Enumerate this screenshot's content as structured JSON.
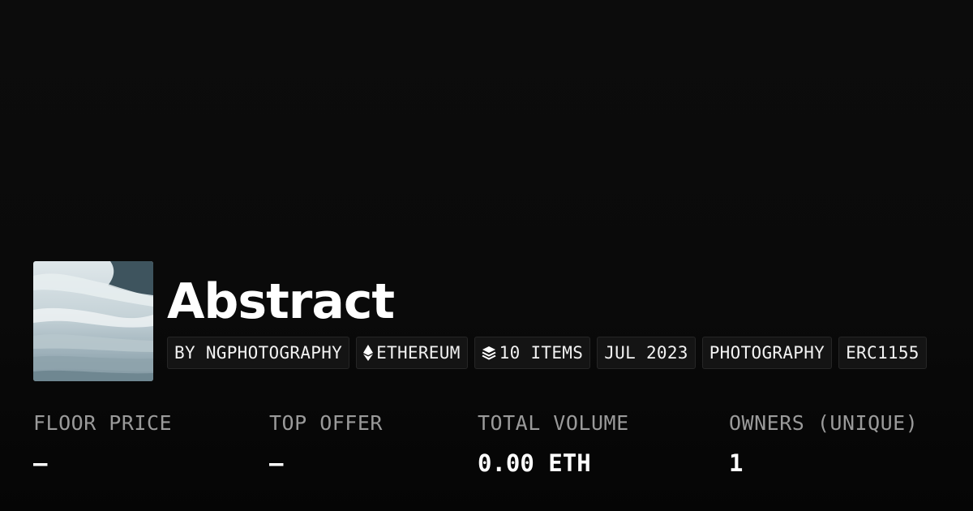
{
  "collection": {
    "name": "Abstract",
    "image_alt": "abstract photograph thumbnail"
  },
  "tags": [
    {
      "label": "BY NGPHOTOGRAPHY",
      "icon": null
    },
    {
      "label": "ETHEREUM",
      "icon": "ethereum-icon"
    },
    {
      "label": "10 ITEMS",
      "icon": "layers-icon"
    },
    {
      "label": "JUL 2023",
      "icon": null
    },
    {
      "label": "PHOTOGRAPHY",
      "icon": null
    },
    {
      "label": "ERC1155",
      "icon": null
    }
  ],
  "stats": {
    "floor_price": {
      "label": "FLOOR PRICE",
      "value": "—"
    },
    "top_offer": {
      "label": "TOP OFFER",
      "value": "—"
    },
    "total_volume": {
      "label": "TOTAL VOLUME",
      "value": "0.00 ETH"
    },
    "owners": {
      "label": "OWNERS (UNIQUE)",
      "value": "1"
    }
  },
  "colors": {
    "background": "#0a0a0a",
    "text": "#ffffff",
    "muted": "#9a9a9a",
    "tag_bg": "#141414",
    "tag_border": "#262626"
  }
}
